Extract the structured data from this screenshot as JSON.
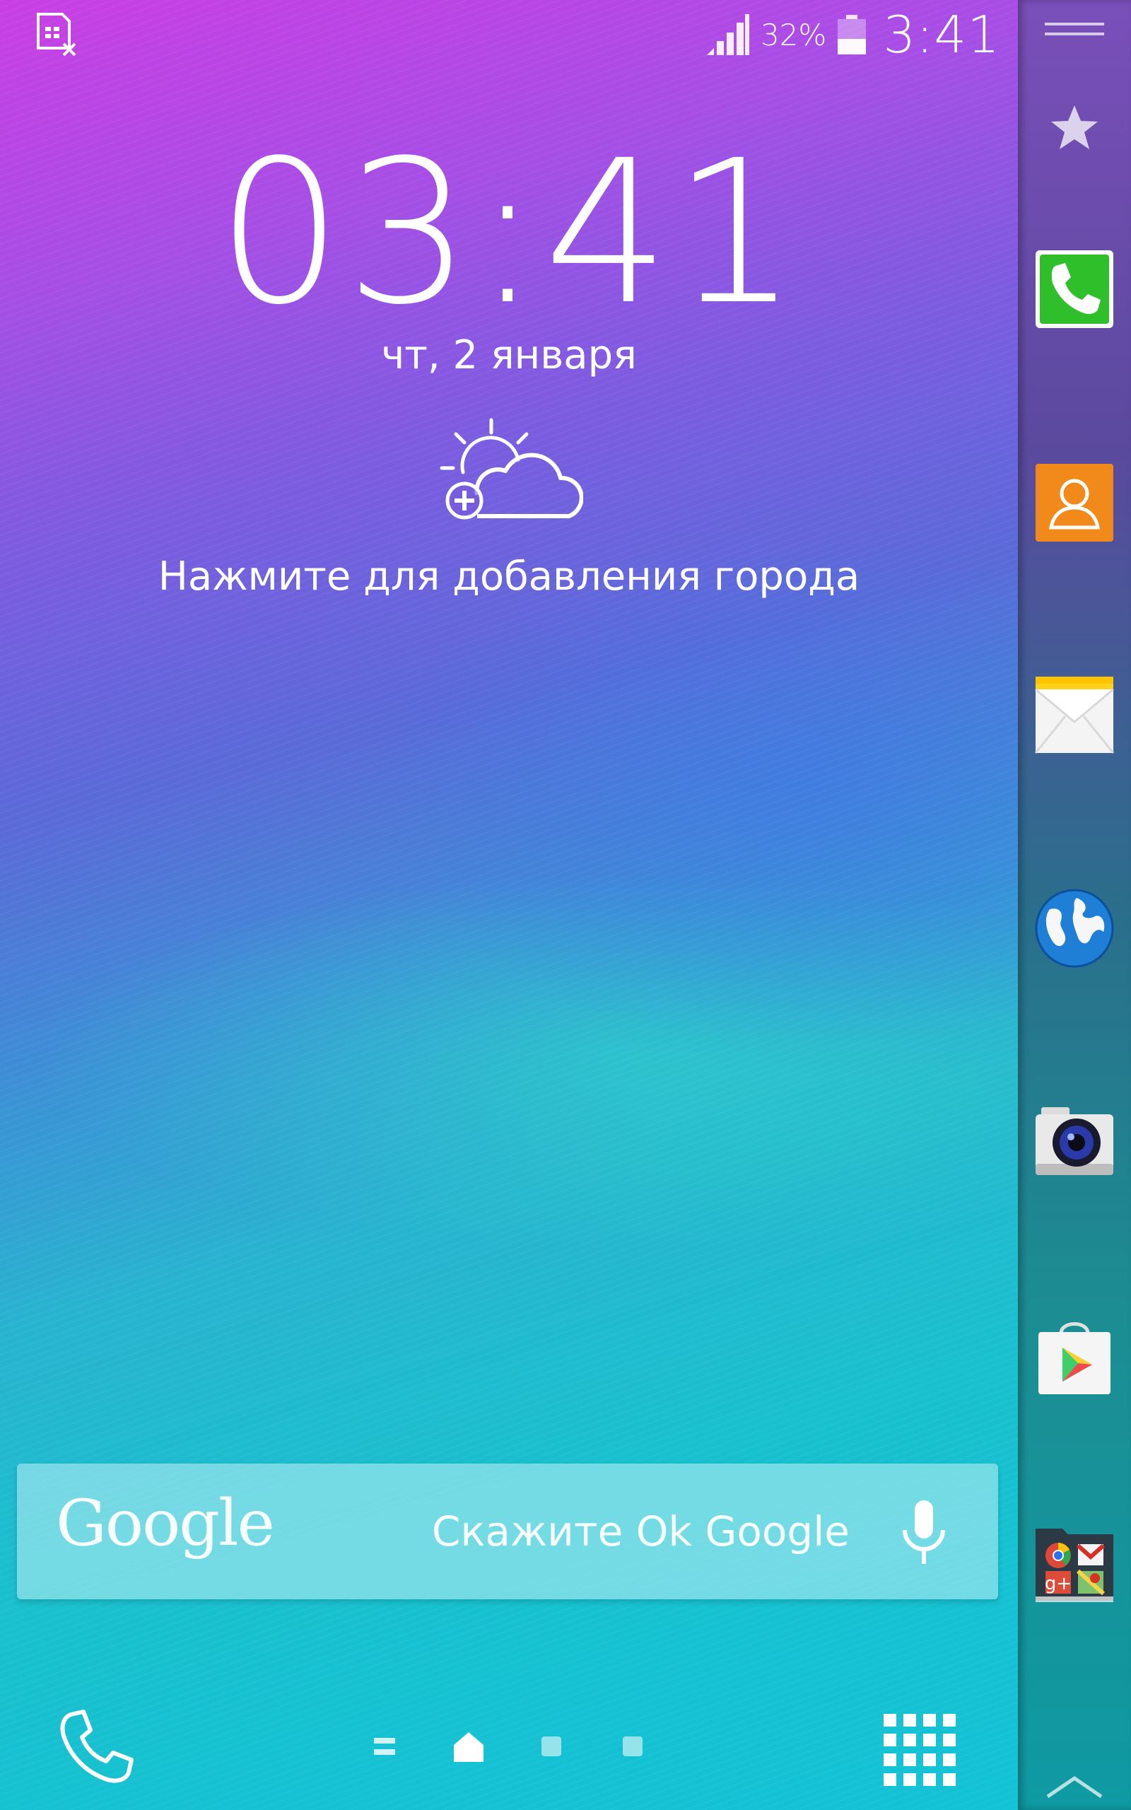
{
  "status_bar": {
    "battery_percent": "32%",
    "time": "3:41",
    "icons": [
      "sim-card-missing-icon",
      "signal-strength-icon",
      "battery-icon"
    ]
  },
  "lockscreen": {
    "clock": "03:41",
    "date": "чт, 2 января",
    "weather_hint": "Нажмите для добавления города",
    "weather_icon": "weather-sun-cloud-add-icon"
  },
  "google_bar": {
    "logo": "Google",
    "hint": "Скажите Ok Google",
    "icon": "microphone-icon"
  },
  "dock": {
    "left_icon": "phone-icon",
    "right_icon": "apps-grid-icon",
    "page_indicators": [
      "list-icon",
      "home-icon",
      "page-dot",
      "page-dot"
    ],
    "active_page": 1
  },
  "edge_panel": {
    "icons": [
      "handle-icon",
      "favorite-star-icon",
      "phone-app-icon",
      "contacts-app-icon",
      "messages-app-icon",
      "browser-app-icon",
      "camera-app-icon",
      "play-store-app-icon",
      "google-folder-icon",
      "chevron-up-icon"
    ]
  },
  "colors": {
    "wallpaper_top": "#c93fe3",
    "wallpaper_bottom": "#12c2d6",
    "phone_green": "#2fbf2a",
    "contacts_orange": "#f28a1b",
    "messages_yellow": "#ffd21a"
  }
}
